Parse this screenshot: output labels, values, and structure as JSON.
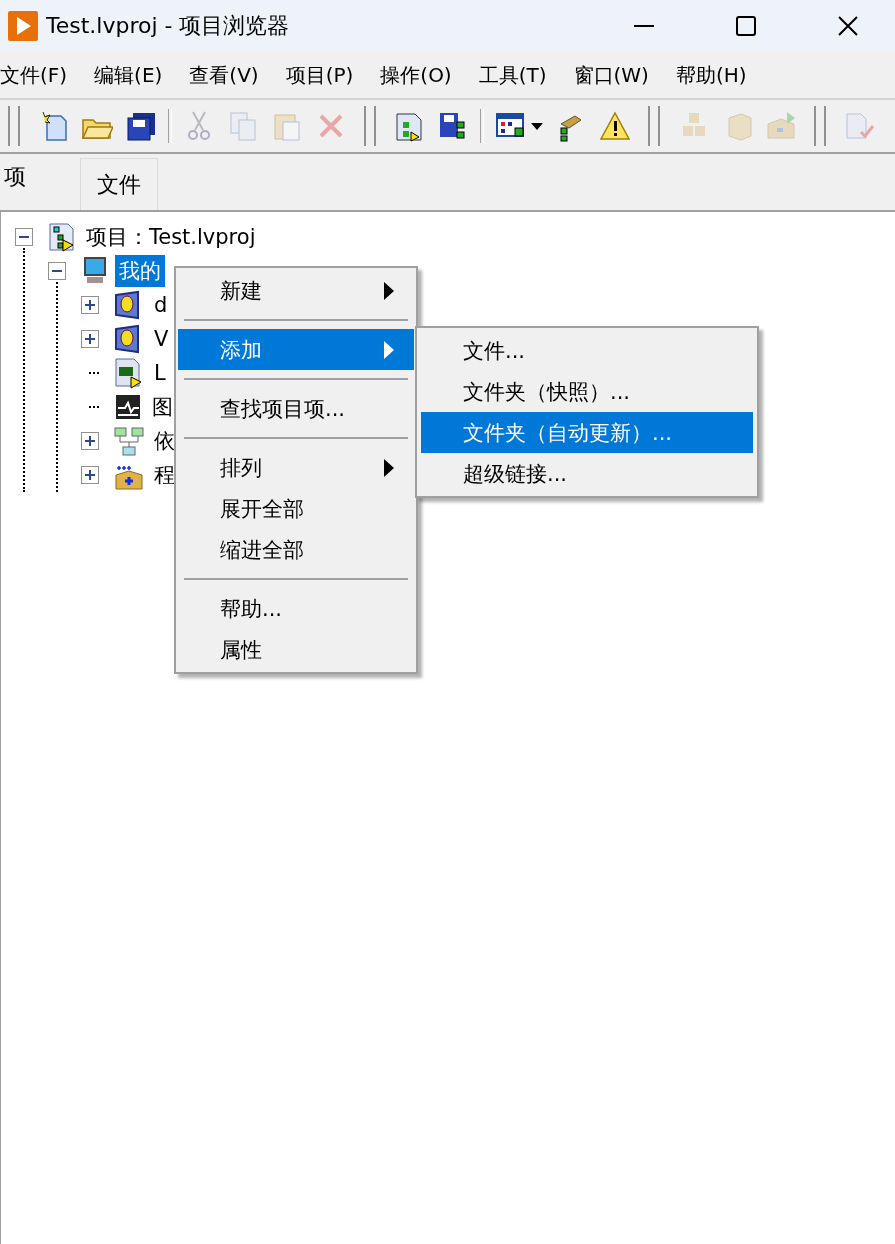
{
  "window": {
    "title": "Test.lvproj - 项目浏览器"
  },
  "menu_bar": [
    "文件(F)",
    "编辑(E)",
    "查看(V)",
    "项目(P)",
    "操作(O)",
    "工具(T)",
    "窗口(W)",
    "帮助(H)"
  ],
  "toolbar": [
    {
      "kind": "grip"
    },
    {
      "kind": "new",
      "disabled": false
    },
    {
      "kind": "open",
      "disabled": false
    },
    {
      "kind": "save-all",
      "disabled": false
    },
    {
      "kind": "separator"
    },
    {
      "kind": "cut",
      "disabled": true
    },
    {
      "kind": "copy",
      "disabled": true
    },
    {
      "kind": "paste",
      "disabled": true
    },
    {
      "kind": "delete",
      "disabled": true
    },
    {
      "kind": "grip"
    },
    {
      "kind": "project-doc",
      "disabled": false
    },
    {
      "kind": "save-tree",
      "disabled": false
    },
    {
      "kind": "separator"
    },
    {
      "kind": "grid",
      "disabled": false
    },
    {
      "kind": "dropdown",
      "disabled": false
    },
    {
      "kind": "tool",
      "disabled": false
    },
    {
      "kind": "warning",
      "disabled": false
    },
    {
      "kind": "grip"
    },
    {
      "kind": "build",
      "disabled": true
    },
    {
      "kind": "box",
      "disabled": true
    },
    {
      "kind": "deploy",
      "disabled": true
    },
    {
      "kind": "grip"
    },
    {
      "kind": "check-doc",
      "disabled": true
    }
  ],
  "tabs": [
    {
      "label": "项",
      "selected": true
    },
    {
      "label": "文件",
      "selected": false
    }
  ],
  "tree": [
    {
      "label": "项目：Test.lvproj",
      "kind": "project",
      "has_expander": true,
      "expanded": true,
      "selected": false,
      "children": [
        {
          "label": "我的",
          "kind": "computer",
          "has_expander": true,
          "expanded": true,
          "selected": true,
          "children": [
            {
              "label": "d",
              "kind": "library",
              "has_expander": true,
              "expanded": false,
              "selected": false
            },
            {
              "label": "V",
              "kind": "library",
              "has_expander": true,
              "expanded": false,
              "selected": false
            },
            {
              "label": "L",
              "kind": "vi",
              "has_expander": false,
              "expanded": false,
              "selected": false
            },
            {
              "label": "图",
              "kind": "graph",
              "has_expander": false,
              "expanded": false,
              "selected": false
            },
            {
              "label": "依",
              "kind": "dependencies",
              "has_expander": true,
              "expanded": false,
              "selected": false
            },
            {
              "label": "程",
              "kind": "build",
              "has_expander": true,
              "expanded": false,
              "selected": false
            }
          ]
        }
      ]
    }
  ],
  "context_menu": {
    "items": [
      {
        "kind": "item",
        "label": "新建",
        "submenu": true,
        "selected": false
      },
      {
        "kind": "separator"
      },
      {
        "kind": "item",
        "label": "添加",
        "submenu": true,
        "selected": true
      },
      {
        "kind": "separator"
      },
      {
        "kind": "item",
        "label": "查找项目项...",
        "submenu": false,
        "selected": false
      },
      {
        "kind": "separator"
      },
      {
        "kind": "item",
        "label": "排列",
        "submenu": true,
        "selected": false
      },
      {
        "kind": "item",
        "label": "展开全部",
        "submenu": false,
        "selected": false
      },
      {
        "kind": "item",
        "label": "缩进全部",
        "submenu": false,
        "selected": false
      },
      {
        "kind": "separator"
      },
      {
        "kind": "item",
        "label": "帮助...",
        "submenu": false,
        "selected": false
      },
      {
        "kind": "item",
        "label": "属性",
        "submenu": false,
        "selected": false
      }
    ]
  },
  "submenu": {
    "items": [
      {
        "label": "文件...",
        "selected": false
      },
      {
        "label": "文件夹（快照）...",
        "selected": false
      },
      {
        "label": "文件夹（自动更新）...",
        "selected": true
      },
      {
        "label": "超级链接...",
        "selected": false
      }
    ]
  }
}
